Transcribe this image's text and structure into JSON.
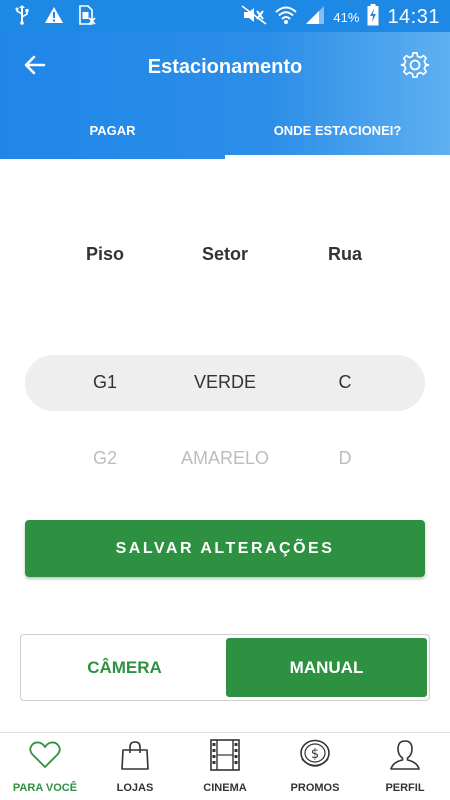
{
  "status_bar": {
    "battery_percent": "41%",
    "time": "14:31",
    "icons": [
      "usb-icon",
      "warning-icon",
      "sim-card-icon",
      "mute-icon",
      "wifi-icon",
      "signal-icon",
      "battery-charging-icon"
    ]
  },
  "header": {
    "title": "Estacionamento",
    "back_icon": "arrow-left-icon",
    "settings_icon": "gear-icon"
  },
  "tabs": [
    {
      "label": "PAGAR",
      "active": false
    },
    {
      "label": "ONDE ESTACIONEI?",
      "active": true
    }
  ],
  "picker": {
    "columns": [
      "Piso",
      "Setor",
      "Rua"
    ],
    "selected": [
      "G1",
      "VERDE",
      "C"
    ],
    "next": [
      "G2",
      "AMARELO",
      "D"
    ]
  },
  "save_button": {
    "label": "SALVAR ALTERAÇÕES"
  },
  "mode_toggle": {
    "camera_label": "CÂMERA",
    "manual_label": "MANUAL",
    "selected": "MANUAL"
  },
  "bottom_nav": [
    {
      "label": "PARA VOCÊ",
      "icon": "heart-icon",
      "active": true
    },
    {
      "label": "LOJAS",
      "icon": "shopping-bag-icon",
      "active": false
    },
    {
      "label": "CINEMA",
      "icon": "film-strip-icon",
      "active": false
    },
    {
      "label": "PROMOS",
      "icon": "dollar-coin-icon",
      "active": false
    },
    {
      "label": "PERFIL",
      "icon": "person-icon",
      "active": false
    }
  ],
  "colors": {
    "primary_blue": "#1e88e5",
    "accent_green": "#2e9142",
    "selected_row_bg": "#eeeeee",
    "faded_text": "#bdbdbd"
  }
}
